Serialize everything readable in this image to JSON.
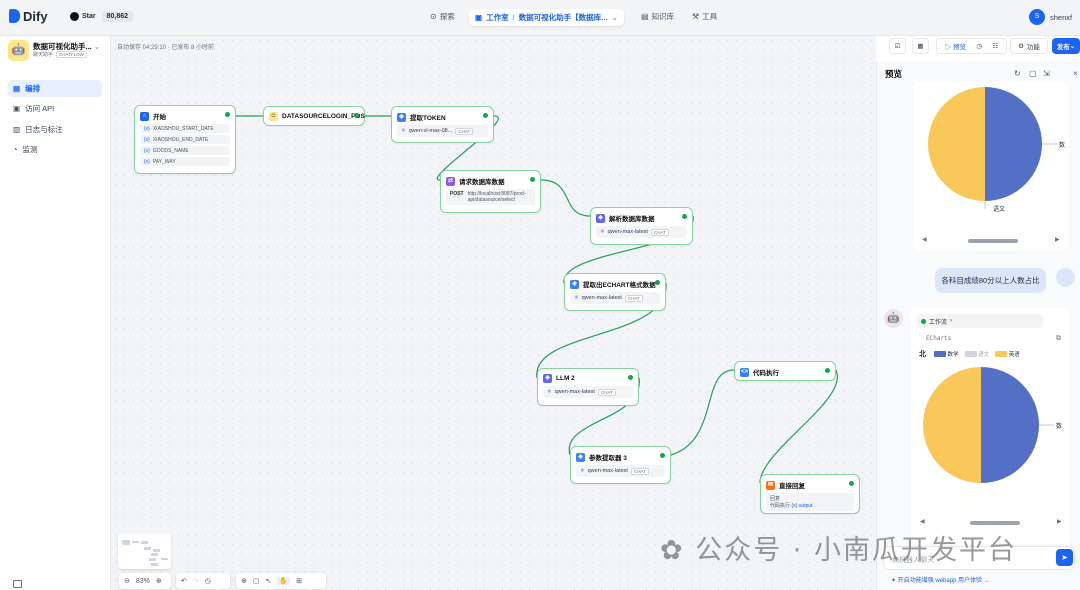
{
  "topbar": {
    "logo": "Dify",
    "star_label": "Star",
    "star_count": "80,862",
    "nav_explore": "探索",
    "nav_studio": "工作室",
    "current_app": "数据可视化助手【数据库...",
    "nav_knowledge": "知识库",
    "nav_tools": "工具",
    "user_initial": "S",
    "user_name": "shenxf"
  },
  "sidebar": {
    "app_name": "数据可视化助手...",
    "app_type": "聊天助手",
    "app_mode": "CHATFLOW",
    "items": [
      {
        "label": "编排",
        "icon": "layout-icon",
        "active": true
      },
      {
        "label": "访问 API",
        "icon": "api-icon",
        "active": false
      },
      {
        "label": "日志与标注",
        "icon": "log-icon",
        "active": false
      },
      {
        "label": "监测",
        "icon": "monitor-icon",
        "active": false
      }
    ]
  },
  "canvas": {
    "autosave": "自动保存 04:29:10 · 已发布 8 小时前",
    "zoom": "83%"
  },
  "nodes": {
    "start": {
      "title": "开始",
      "vars": [
        "XIAOSHOU_START_DATE",
        "XIAOSHOU_END_DATE",
        "GOODS_NAME",
        "PAY_WAY"
      ]
    },
    "datasource": {
      "title": "DATASOURCELOGIN_POS"
    },
    "token": {
      "title": "提取TOKEN",
      "model": "qwen-vl-max-08...",
      "tag": "CHAT"
    },
    "request": {
      "title": "请求数据库数据",
      "method": "POST",
      "url": "http://localhost:8087/prod-api/datasource/select"
    },
    "parse": {
      "title": "解析数据库数据",
      "model": "qwen-max-latest",
      "tag": "CHAT"
    },
    "extract": {
      "title": "提取出ECHART格式数据",
      "model": "qwen-max-latest",
      "tag": "CHAT"
    },
    "llm2": {
      "title": "LLM 2",
      "model": "qwen-max-latest",
      "tag": "CHAT"
    },
    "param": {
      "title": "参数提取器 3",
      "model": "qwen-max-latest",
      "tag": "CHAT"
    },
    "code": {
      "title": "代码执行"
    },
    "answer": {
      "title": "直接回复",
      "label": "回复",
      "var_source": "代码执行",
      "var_name": "{x} output"
    }
  },
  "toolbar_right": {
    "preview": "预览",
    "features": "功能",
    "publish": "发布"
  },
  "preview": {
    "title": "预览",
    "top_chart_labels": {
      "right": "数",
      "bottom": "语文"
    },
    "user_message": "各科目成绩80分以上人数占比",
    "workflow_label": "工作流",
    "echarts_label": "ECharts",
    "legend": [
      {
        "name": "数学",
        "color": "#5470c6"
      },
      {
        "name": "语文",
        "color": "#d1d5db"
      },
      {
        "name": "英语",
        "color": "#fac858"
      }
    ],
    "legend_side": "北",
    "pie_right_label": "数",
    "input_placeholder": "和机器人聊天",
    "footer": "开启功能增强 webapp 用户体验"
  },
  "colors": {
    "accent": "#1c64f2",
    "node_border": "#86d3a0",
    "edge": "#22a05a",
    "pie_blue": "#5470c6",
    "pie_yellow": "#fac858"
  },
  "watermark": "公众号 · 小南瓜开发平台"
}
